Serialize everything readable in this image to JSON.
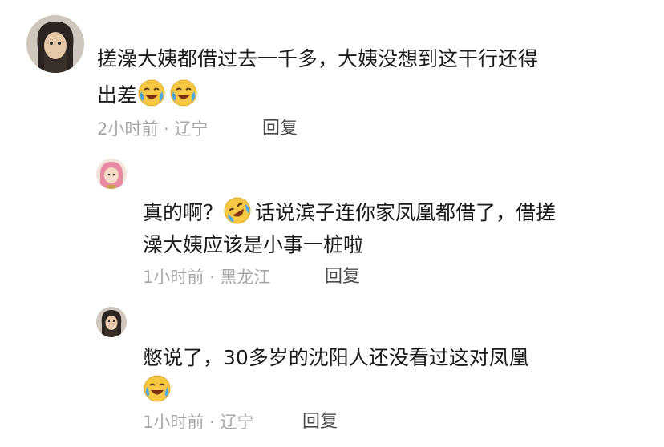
{
  "comments": [
    {
      "avatar_icon": "bearded-man-avatar-icon",
      "line1": "搓澡大姨都借过去一千多，大姨没想到这干行还得",
      "line2": "出差",
      "emojis": [
        "laugh-cry-emoji-icon",
        "laugh-cry-emoji-icon"
      ],
      "time": "2小时前",
      "separator": "·",
      "location": "辽宁",
      "reply_label": "回复"
    },
    {
      "avatar_icon": "pink-hair-girl-avatar-icon",
      "line1_prefix": "真的啊？",
      "line1_suffix": "话说滨子连你家凤凰都借了，借搓",
      "line2": "澡大姨应该是小事一桩啦",
      "emoji": "rofl-emoji-icon",
      "time": "1小时前",
      "separator": "·",
      "location": "黑龙江",
      "reply_label": "回复"
    },
    {
      "avatar_icon": "bearded-man-avatar-icon",
      "line1": "憋说了，30多岁的沈阳人还没看过这对凤凰",
      "emoji": "laugh-cry-emoji-icon",
      "time": "1小时前",
      "separator": "·",
      "location": "辽宁",
      "reply_label": "回复"
    }
  ],
  "colors": {
    "text": "#1a1a1a",
    "meta": "#a6a6a6",
    "reply": "#4a4a4a",
    "emoji_yellow": "#f7c843",
    "tears": "#4aa8f0"
  }
}
